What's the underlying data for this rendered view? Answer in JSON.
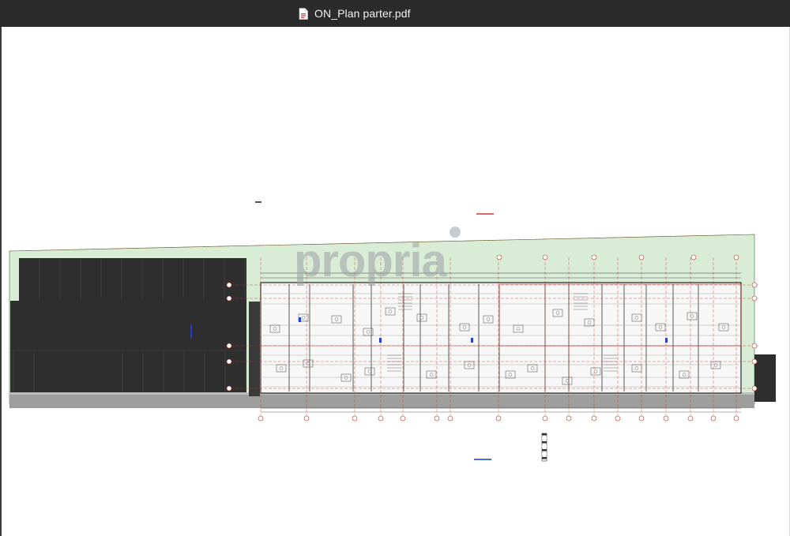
{
  "window": {
    "title": "ON_Plan parter.pdf",
    "file_icon": "pdf-document-icon"
  },
  "document": {
    "watermark_text": "propria",
    "colors": {
      "titlebar": "#2b2b2b",
      "page": "#ffffff",
      "green_area": "#d9ecd6",
      "parking_dark": "#2e2e2e",
      "gridline_red": "#c0392b",
      "road_gray": "#9e9e9e"
    }
  }
}
